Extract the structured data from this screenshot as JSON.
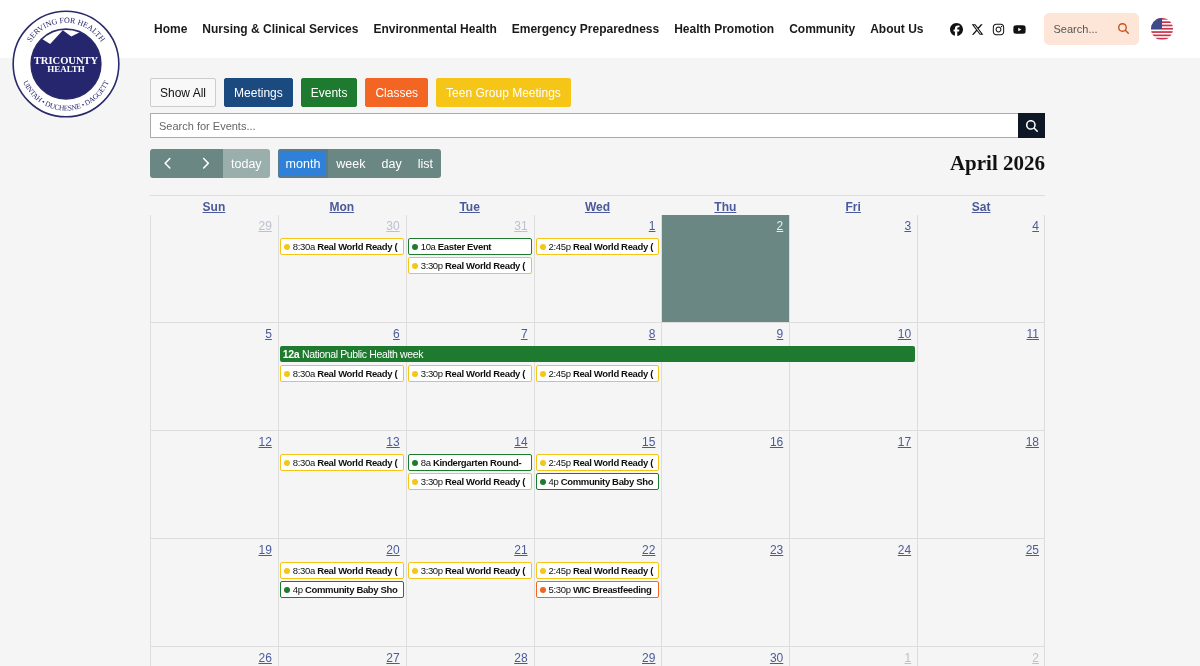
{
  "logo": {
    "top_text": "SERVING FOR HEALTH",
    "name_line_1": "TRICOUNTY",
    "name_line_2": "HEALTH",
    "bottom_text": "UINTAH • DUCHESNE • DAGGETT"
  },
  "nav": [
    "Home",
    "Nursing & Clinical Services",
    "Environmental Health",
    "Emergency Preparedness",
    "Health Promotion",
    "Community",
    "About Us"
  ],
  "header_search": {
    "placeholder": "Search..."
  },
  "filters": [
    {
      "label": "Show All",
      "color": "#f8f8f8"
    },
    {
      "label": "Meetings",
      "color": "#1b4a80"
    },
    {
      "label": "Events",
      "color": "#1e7a2e"
    },
    {
      "label": "Classes",
      "color": "#f26522"
    },
    {
      "label": "Teen Group Meetings",
      "color": "#f5c518"
    }
  ],
  "event_search": {
    "placeholder": "Search for Events..."
  },
  "toolbar": {
    "today": {
      "label": "today",
      "disabled": true
    },
    "views": [
      {
        "label": "month",
        "selected": true
      },
      {
        "label": "week",
        "selected": false
      },
      {
        "label": "day",
        "selected": false
      },
      {
        "label": "list",
        "selected": false
      }
    ],
    "title": "April 2026"
  },
  "weekdays": [
    "Sun",
    "Mon",
    "Tue",
    "Wed",
    "Thu",
    "Fri",
    "Sat"
  ],
  "weeks": [
    {
      "days": [
        {
          "date": "29",
          "other_month": true,
          "today": false
        },
        {
          "date": "30",
          "other_month": true,
          "today": false,
          "events": [
            {
              "kind": "event",
              "time": "8:30a",
              "title": "Real World Ready (",
              "color": "#f5c518"
            }
          ]
        },
        {
          "date": "31",
          "other_month": true,
          "today": false,
          "events": [
            {
              "kind": "event",
              "time": "10a",
              "title": "Easter Event",
              "color": "#1e7a2e"
            },
            {
              "kind": "event",
              "time": "3:30p",
              "title": "Real World Ready (",
              "color": "#f5c518"
            }
          ]
        },
        {
          "date": "1",
          "other_month": false,
          "today": false,
          "events": [
            {
              "kind": "event",
              "time": "2:45p",
              "title": "Real World Ready (",
              "color": "#f5c518"
            }
          ]
        },
        {
          "date": "2",
          "other_month": false,
          "today": true
        },
        {
          "date": "3",
          "other_month": false,
          "today": false
        },
        {
          "date": "4",
          "other_month": false,
          "today": false
        }
      ]
    },
    {
      "days": [
        {
          "date": "5",
          "other_month": false,
          "today": false
        },
        {
          "date": "6",
          "other_month": false,
          "today": false,
          "events": [
            {
              "kind": "span_start",
              "time": "12a",
              "title": "National Public Health week",
              "color": "#1e7a2e"
            },
            {
              "kind": "event",
              "time": "8:30a",
              "title": "Real World Ready (",
              "color": "#f5c518"
            }
          ]
        },
        {
          "date": "7",
          "other_month": false,
          "today": false,
          "events": [
            {
              "kind": "span_continue"
            },
            {
              "kind": "event",
              "time": "3:30p",
              "title": "Real World Ready (",
              "color": "#f5c518"
            }
          ]
        },
        {
          "date": "8",
          "other_month": false,
          "today": false,
          "events": [
            {
              "kind": "span_continue"
            },
            {
              "kind": "event",
              "time": "2:45p",
              "title": "Real World Ready (",
              "color": "#f5c518"
            }
          ]
        },
        {
          "date": "9",
          "other_month": false,
          "today": false,
          "events": [
            {
              "kind": "span_continue"
            }
          ]
        },
        {
          "date": "10",
          "other_month": false,
          "today": false,
          "events": [
            {
              "kind": "span_continue"
            }
          ]
        },
        {
          "date": "11",
          "other_month": false,
          "today": false
        }
      ]
    },
    {
      "days": [
        {
          "date": "12",
          "other_month": false,
          "today": false
        },
        {
          "date": "13",
          "other_month": false,
          "today": false,
          "events": [
            {
              "kind": "event",
              "time": "8:30a",
              "title": "Real World Ready (",
              "color": "#f5c518"
            }
          ]
        },
        {
          "date": "14",
          "other_month": false,
          "today": false,
          "events": [
            {
              "kind": "event",
              "time": "8a",
              "title": "Kindergarten Round-",
              "color": "#1e7a2e"
            },
            {
              "kind": "event",
              "time": "3:30p",
              "title": "Real World Ready (",
              "color": "#f5c518"
            }
          ]
        },
        {
          "date": "15",
          "other_month": false,
          "today": false,
          "events": [
            {
              "kind": "event",
              "time": "2:45p",
              "title": "Real World Ready (",
              "color": "#f5c518"
            },
            {
              "kind": "event",
              "time": "4p",
              "title": "Community Baby Sho",
              "color": "#1e7a2e"
            }
          ]
        },
        {
          "date": "16",
          "other_month": false,
          "today": false
        },
        {
          "date": "17",
          "other_month": false,
          "today": false
        },
        {
          "date": "18",
          "other_month": false,
          "today": false
        }
      ]
    },
    {
      "days": [
        {
          "date": "19",
          "other_month": false,
          "today": false
        },
        {
          "date": "20",
          "other_month": false,
          "today": false,
          "events": [
            {
              "kind": "event",
              "time": "8:30a",
              "title": "Real World Ready (",
              "color": "#f5c518"
            },
            {
              "kind": "event",
              "time": "4p",
              "title": "Community Baby Sho",
              "color": "#1e7a2e"
            }
          ]
        },
        {
          "date": "21",
          "other_month": false,
          "today": false,
          "events": [
            {
              "kind": "event",
              "time": "3:30p",
              "title": "Real World Ready (",
              "color": "#f5c518"
            }
          ]
        },
        {
          "date": "22",
          "other_month": false,
          "today": false,
          "events": [
            {
              "kind": "event",
              "time": "2:45p",
              "title": "Real World Ready (",
              "color": "#f5c518"
            },
            {
              "kind": "event",
              "time": "5:30p",
              "title": "WIC Breastfeeding",
              "color": "#f26522"
            }
          ]
        },
        {
          "date": "23",
          "other_month": false,
          "today": false
        },
        {
          "date": "24",
          "other_month": false,
          "today": false
        },
        {
          "date": "25",
          "other_month": false,
          "today": false
        }
      ]
    },
    {
      "days": [
        {
          "date": "26",
          "other_month": false,
          "today": false
        },
        {
          "date": "27",
          "other_month": false,
          "today": false
        },
        {
          "date": "28",
          "other_month": false,
          "today": false
        },
        {
          "date": "29",
          "other_month": false,
          "today": false
        },
        {
          "date": "30",
          "other_month": false,
          "today": false
        },
        {
          "date": "1",
          "other_month": true,
          "today": false
        },
        {
          "date": "2",
          "other_month": true,
          "today": false
        }
      ]
    }
  ]
}
